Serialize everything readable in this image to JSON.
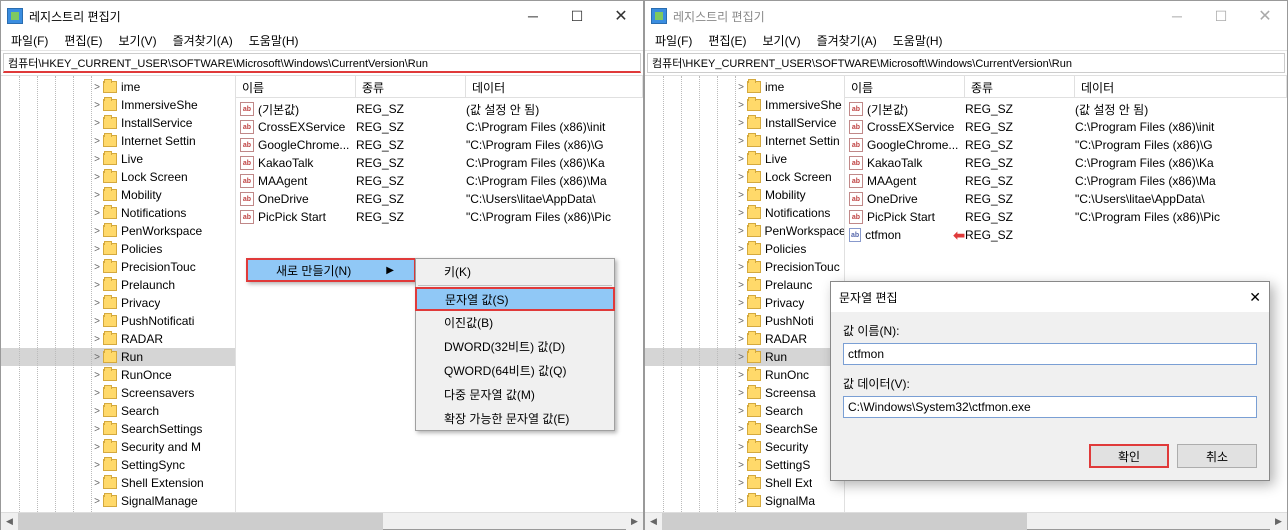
{
  "window_title": "레지스트리 편집기",
  "menu": {
    "file": "파일(F)",
    "edit": "편집(E)",
    "view": "보기(V)",
    "favorites": "즐겨찾기(A)",
    "help": "도움말(H)"
  },
  "address_path": "컴퓨터\\HKEY_CURRENT_USER\\SOFTWARE\\Microsoft\\Windows\\CurrentVersion\\Run",
  "tree_items": [
    "ime",
    "ImmersiveShe",
    "InstallService",
    "Internet Settin",
    "Live",
    "Lock Screen",
    "Mobility",
    "Notifications",
    "PenWorkspace",
    "Policies",
    "PrecisionTouc",
    "Prelaunch",
    "Privacy",
    "PushNotificati",
    "RADAR",
    "Run",
    "RunOnce",
    "Screensavers",
    "Search",
    "SearchSettings",
    "Security and M",
    "SettingSync",
    "Shell Extension",
    "SignalManage"
  ],
  "tree_items_right": [
    "ime",
    "ImmersiveShe",
    "InstallService",
    "Internet Settin",
    "Live",
    "Lock Screen",
    "Mobility",
    "Notifications",
    "PenWorkspace",
    "Policies",
    "PrecisionTouc",
    "Prelaunc",
    "Privacy",
    "PushNoti",
    "RADAR",
    "Run",
    "RunOnc",
    "Screensa",
    "Search",
    "SearchSe",
    "Security",
    "SettingS",
    "Shell Ext",
    "SignalMa"
  ],
  "selected_tree_item": "Run",
  "list_header": {
    "name": "이름",
    "type": "종류",
    "data": "데이터"
  },
  "values_left": [
    {
      "icon": "ab",
      "name": "(기본값)",
      "type": "REG_SZ",
      "data": "(값 설정 안 됨)"
    },
    {
      "icon": "ab",
      "name": "CrossEXService",
      "type": "REG_SZ",
      "data": "C:\\Program Files (x86)\\init"
    },
    {
      "icon": "ab",
      "name": "GoogleChrome...",
      "type": "REG_SZ",
      "data": "\"C:\\Program Files (x86)\\G"
    },
    {
      "icon": "ab",
      "name": "KakaoTalk",
      "type": "REG_SZ",
      "data": "C:\\Program Files (x86)\\Ka"
    },
    {
      "icon": "ab",
      "name": "MAAgent",
      "type": "REG_SZ",
      "data": "C:\\Program Files (x86)\\Ma"
    },
    {
      "icon": "ab",
      "name": "OneDrive",
      "type": "REG_SZ",
      "data": "\"C:\\Users\\litae\\AppData\\"
    },
    {
      "icon": "ab",
      "name": "PicPick Start",
      "type": "REG_SZ",
      "data": "\"C:\\Program Files (x86)\\Pic"
    }
  ],
  "values_right": [
    {
      "icon": "ab",
      "name": "(기본값)",
      "type": "REG_SZ",
      "data": "(값 설정 안 됨)"
    },
    {
      "icon": "ab",
      "name": "CrossEXService",
      "type": "REG_SZ",
      "data": "C:\\Program Files (x86)\\init"
    },
    {
      "icon": "ab",
      "name": "GoogleChrome...",
      "type": "REG_SZ",
      "data": "\"C:\\Program Files (x86)\\G"
    },
    {
      "icon": "ab",
      "name": "KakaoTalk",
      "type": "REG_SZ",
      "data": "C:\\Program Files (x86)\\Ka"
    },
    {
      "icon": "ab",
      "name": "MAAgent",
      "type": "REG_SZ",
      "data": "C:\\Program Files (x86)\\Ma"
    },
    {
      "icon": "ab",
      "name": "OneDrive",
      "type": "REG_SZ",
      "data": "\"C:\\Users\\litae\\AppData\\"
    },
    {
      "icon": "ab",
      "name": "PicPick Start",
      "type": "REG_SZ",
      "data": "\"C:\\Program Files (x86)\\Pic"
    },
    {
      "icon": "ab_blue",
      "name": "ctfmon",
      "type": "REG_SZ",
      "data": "",
      "arrow": true
    }
  ],
  "context_menu": {
    "new_label": "새로 만들기(N)",
    "sub": {
      "key": "키(K)",
      "string": "문자열 값(S)",
      "binary": "이진값(B)",
      "dword": "DWORD(32비트) 값(D)",
      "qword": "QWORD(64비트) 값(Q)",
      "multi": "다중 문자열 값(M)",
      "expand": "확장 가능한 문자열 값(E)"
    }
  },
  "dialog": {
    "title": "문자열 편집",
    "name_label": "값 이름(N):",
    "name_value": "ctfmon",
    "data_label": "값 데이터(V):",
    "data_value": "C:\\Windows\\System32\\ctfmon.exe",
    "ok": "확인",
    "cancel": "취소"
  }
}
